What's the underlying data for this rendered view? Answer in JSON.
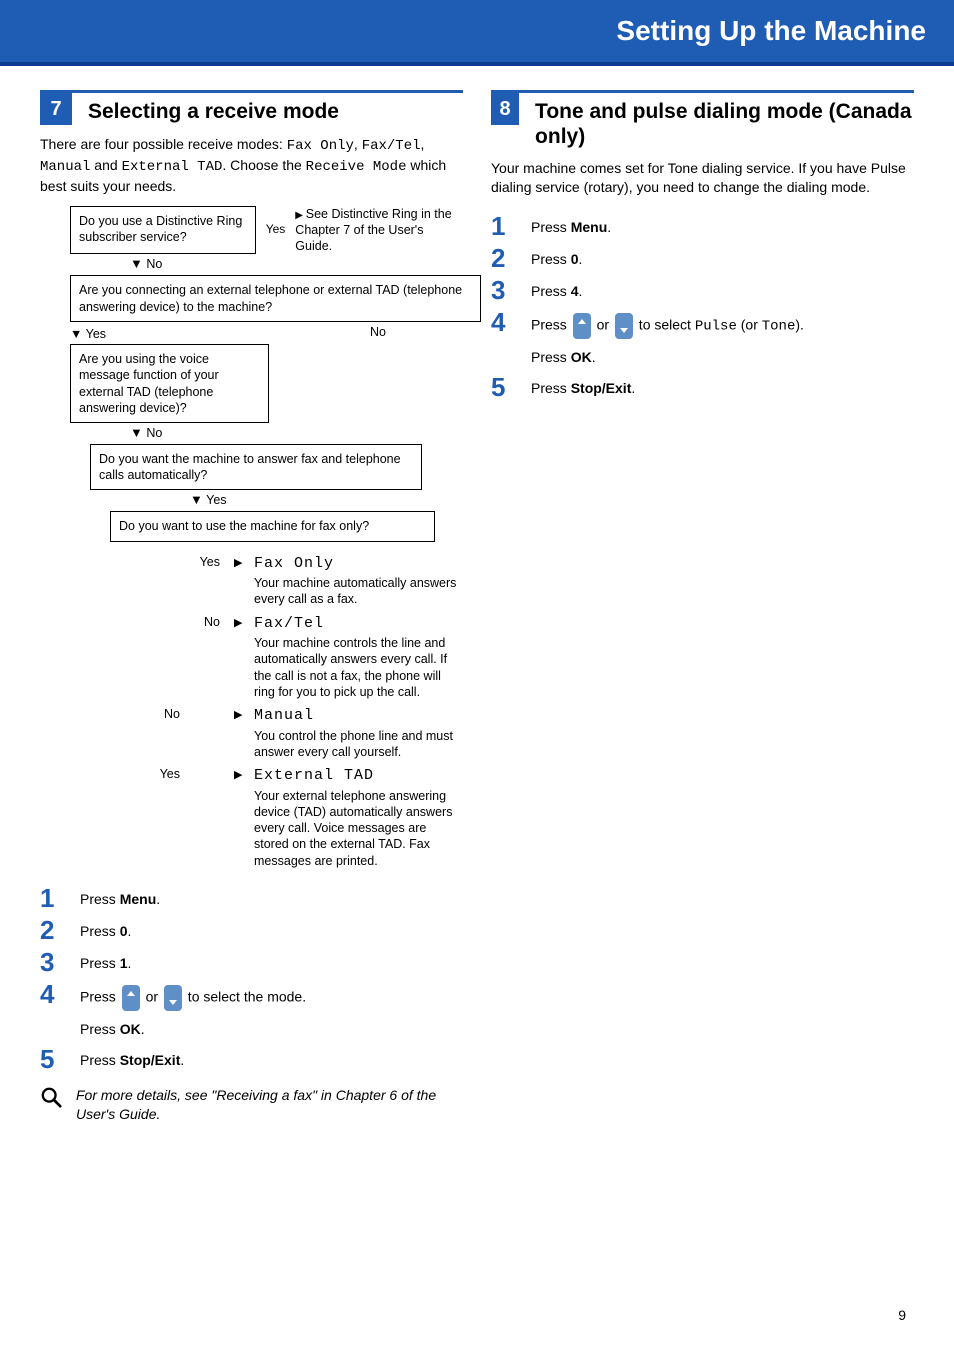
{
  "header": {
    "title": "Setting Up the Machine"
  },
  "page_number": "9",
  "left": {
    "num": "7",
    "title": "Selecting a receive mode",
    "intro_parts": {
      "t1": "There are four possible receive modes: ",
      "m1": "Fax Only",
      "t2": ", ",
      "m2": "Fax/Tel",
      "t3": ", ",
      "m3": "Manual",
      "t4": " and ",
      "m4": "External TAD",
      "t5": ". Choose the ",
      "m5": "Receive Mode",
      "t6": " which best suits your needs."
    },
    "flow": {
      "q1": "Do you use a Distinctive Ring subscriber service?",
      "q1_yes": "Yes",
      "q1_right": "See Distinctive Ring in the Chapter 7 of the User's Guide.",
      "q1_no": "No",
      "q2": "Are you connecting an external telephone or external TAD (telephone answering device) to the machine?",
      "q2_yes": "Yes",
      "q2_no": "No",
      "q3": "Are you using the voice message function of your external TAD (telephone answering device)?",
      "q3_no": "No",
      "q4": "Do you want the machine to answer fax and telephone calls automatically?",
      "q4_yes": "Yes",
      "q5": "Do you want to use the machine for fax only?",
      "outcomes": {
        "fax_only": {
          "label": "Yes",
          "name": "Fax Only",
          "desc": "Your machine automatically answers every call as a fax."
        },
        "fax_tel": {
          "label": "No",
          "name": "Fax/Tel",
          "desc": "Your machine controls the line and automatically answers every call. If the call is not a fax, the phone will ring for you to pick up the call."
        },
        "manual": {
          "label": "No",
          "name": "Manual",
          "desc": "You control the phone line and must answer every call yourself."
        },
        "ext_tad": {
          "label": "Yes",
          "name": "External TAD",
          "desc": "Your external telephone answering device (TAD) automatically answers every call. Voice messages are stored on the external TAD. Fax messages are printed."
        }
      }
    },
    "steps": {
      "n1": "1",
      "s1_a": "Press ",
      "s1_b": "Menu",
      "s1_c": ".",
      "n2": "2",
      "s2_a": "Press ",
      "s2_b": "0",
      "s2_c": ".",
      "n3": "3",
      "s3_a": "Press ",
      "s3_b": "1",
      "s3_c": ".",
      "n4": "4",
      "s4_a": "Press ",
      "s4_b": " or ",
      "s4_c": " to select the mode.",
      "s4_d": "Press ",
      "s4_e": "OK",
      "s4_f": ".",
      "n5": "5",
      "s5_a": "Press ",
      "s5_b": "Stop/Exit",
      "s5_c": "."
    },
    "note": "For more details, see \"Receiving a fax\" in Chapter 6 of the User's Guide."
  },
  "right": {
    "num": "8",
    "title": "Tone and pulse dialing mode (Canada only)",
    "intro": "Your machine comes set for Tone dialing service. If you have Pulse dialing service (rotary), you need to change the dialing mode.",
    "steps": {
      "n1": "1",
      "s1_a": "Press ",
      "s1_b": "Menu",
      "s1_c": ".",
      "n2": "2",
      "s2_a": "Press ",
      "s2_b": "0",
      "s2_c": ".",
      "n3": "3",
      "s3_a": "Press ",
      "s3_b": "4",
      "s3_c": ".",
      "n4": "4",
      "s4_a": "Press ",
      "s4_b": " or ",
      "s4_c": " to select ",
      "s4_m1": "Pulse",
      "s4_d": " (or ",
      "s4_m2": "Tone",
      "s4_e": ").",
      "s4_f": "Press ",
      "s4_g": "OK",
      "s4_h": ".",
      "n5": "5",
      "s5_a": "Press ",
      "s5_b": "Stop/Exit",
      "s5_c": "."
    }
  }
}
